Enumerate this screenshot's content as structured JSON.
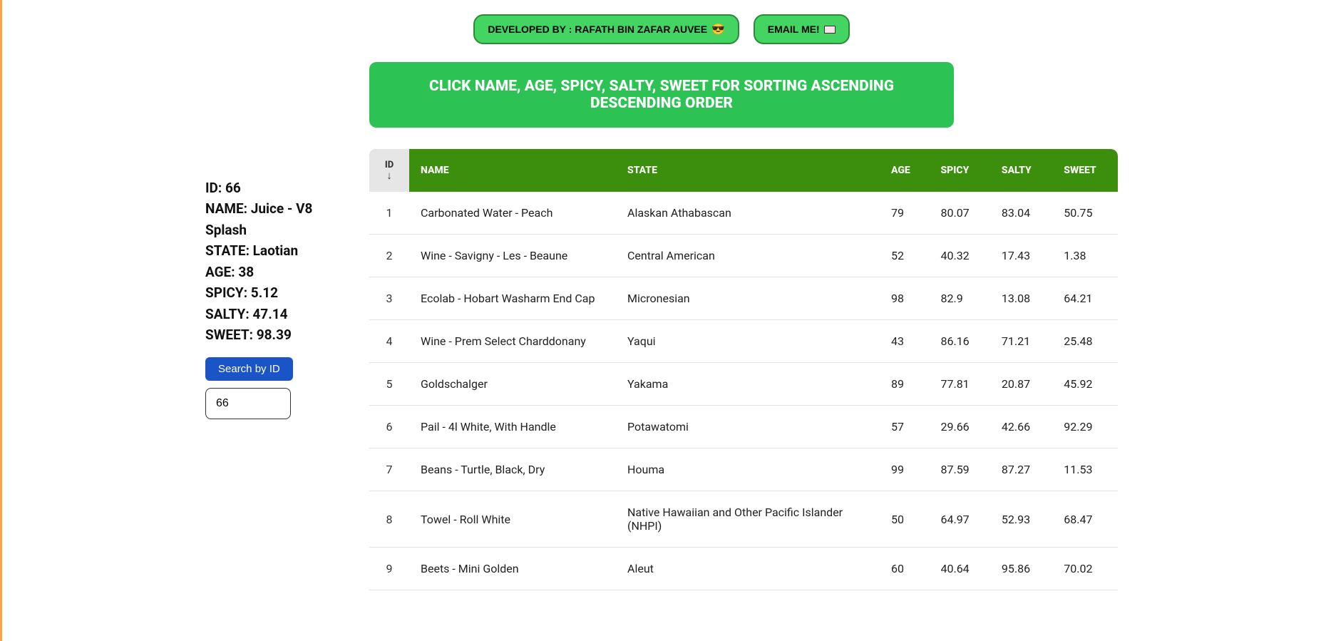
{
  "header": {
    "dev_label": "DEVELOPED BY : RAFATH BIN ZAFAR AUVEE",
    "dev_emoji": "😎",
    "email_label": "EMAIL ME!"
  },
  "banner": "CLICK NAME, AGE, SPICY, SALTY, SWEET FOR SORTING ASCENDING DESCENDING ORDER",
  "detail": {
    "id_label": "ID:",
    "id_value": "66",
    "name_label": "NAME:",
    "name_value": "Juice - V8 Splash",
    "state_label": "STATE:",
    "state_value": "Laotian",
    "age_label": "AGE:",
    "age_value": "38",
    "spicy_label": "SPICY:",
    "spicy_value": "5.12",
    "salty_label": "SALTY:",
    "salty_value": "47.14",
    "sweet_label": "SWEET:",
    "sweet_value": "98.39"
  },
  "search": {
    "button_label": "Search by ID",
    "input_value": "66"
  },
  "table": {
    "headers": {
      "id": "ID",
      "name": "NAME",
      "state": "STATE",
      "age": "AGE",
      "spicy": "SPICY",
      "salty": "SALTY",
      "sweet": "SWEET"
    },
    "rows": [
      {
        "id": "1",
        "name": "Carbonated Water - Peach",
        "state": "Alaskan Athabascan",
        "age": "79",
        "spicy": "80.07",
        "salty": "83.04",
        "sweet": "50.75"
      },
      {
        "id": "2",
        "name": "Wine - Savigny - Les - Beaune",
        "state": "Central American",
        "age": "52",
        "spicy": "40.32",
        "salty": "17.43",
        "sweet": "1.38"
      },
      {
        "id": "3",
        "name": "Ecolab - Hobart Washarm End Cap",
        "state": "Micronesian",
        "age": "98",
        "spicy": "82.9",
        "salty": "13.08",
        "sweet": "64.21"
      },
      {
        "id": "4",
        "name": "Wine - Prem Select Charddonany",
        "state": "Yaqui",
        "age": "43",
        "spicy": "86.16",
        "salty": "71.21",
        "sweet": "25.48"
      },
      {
        "id": "5",
        "name": "Goldschalger",
        "state": "Yakama",
        "age": "89",
        "spicy": "77.81",
        "salty": "20.87",
        "sweet": "45.92"
      },
      {
        "id": "6",
        "name": "Pail - 4l White, With Handle",
        "state": "Potawatomi",
        "age": "57",
        "spicy": "29.66",
        "salty": "42.66",
        "sweet": "92.29"
      },
      {
        "id": "7",
        "name": "Beans - Turtle, Black, Dry",
        "state": "Houma",
        "age": "99",
        "spicy": "87.59",
        "salty": "87.27",
        "sweet": "11.53"
      },
      {
        "id": "8",
        "name": "Towel - Roll White",
        "state": "Native Hawaiian and Other Pacific Islander (NHPI)",
        "age": "50",
        "spicy": "64.97",
        "salty": "52.93",
        "sweet": "68.47"
      },
      {
        "id": "9",
        "name": "Beets - Mini Golden",
        "state": "Aleut",
        "age": "60",
        "spicy": "40.64",
        "salty": "95.86",
        "sweet": "70.02"
      }
    ]
  }
}
